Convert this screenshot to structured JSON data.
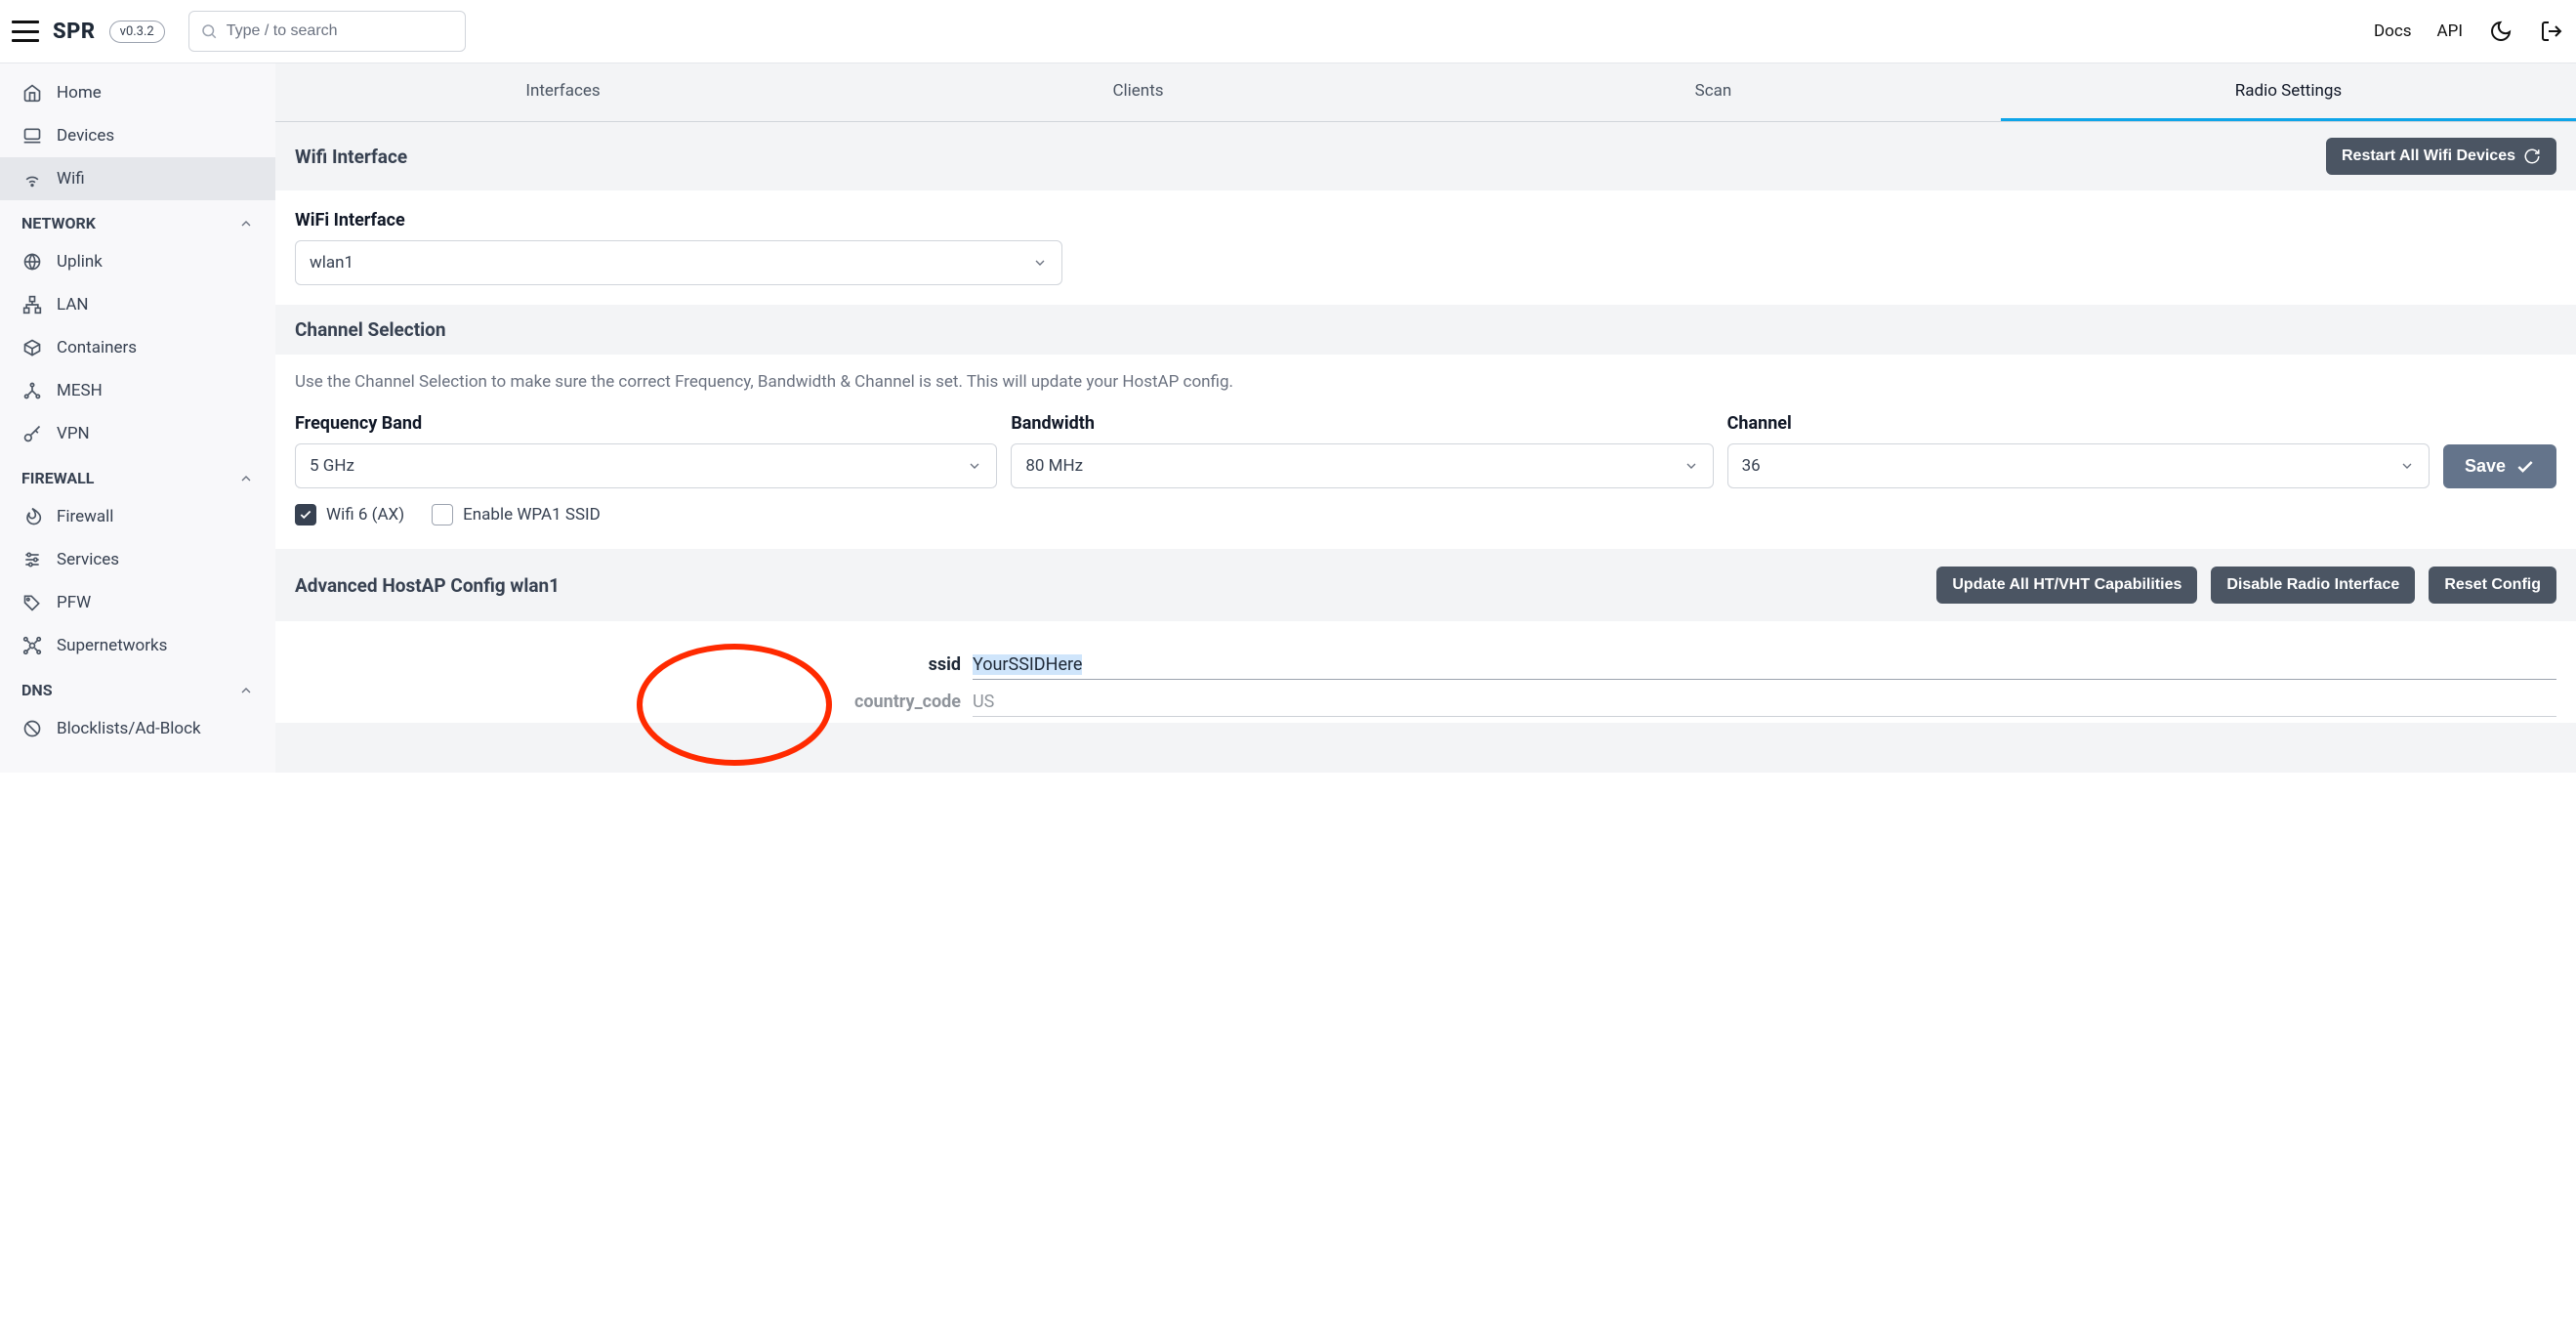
{
  "header": {
    "brand": "SPR",
    "version": "v0.3.2",
    "search_placeholder": "Type / to search",
    "links": {
      "docs": "Docs",
      "api": "API"
    }
  },
  "sidebar": {
    "items_top": [
      {
        "label": "Home",
        "icon": "home"
      },
      {
        "label": "Devices",
        "icon": "laptop"
      },
      {
        "label": "Wifi",
        "icon": "wifi",
        "active": true
      }
    ],
    "groups": [
      {
        "title": "NETWORK",
        "items": [
          {
            "label": "Uplink",
            "icon": "globe"
          },
          {
            "label": "LAN",
            "icon": "diagram"
          },
          {
            "label": "Containers",
            "icon": "box"
          },
          {
            "label": "MESH",
            "icon": "mesh"
          },
          {
            "label": "VPN",
            "icon": "key"
          }
        ]
      },
      {
        "title": "FIREWALL",
        "items": [
          {
            "label": "Firewall",
            "icon": "flame"
          },
          {
            "label": "Services",
            "icon": "sliders"
          },
          {
            "label": "PFW",
            "icon": "tag"
          },
          {
            "label": "Supernetworks",
            "icon": "network"
          }
        ]
      },
      {
        "title": "DNS",
        "items": [
          {
            "label": "Blocklists/Ad-Block",
            "icon": "ban"
          }
        ]
      }
    ]
  },
  "tabs": [
    {
      "label": "Interfaces"
    },
    {
      "label": "Clients"
    },
    {
      "label": "Scan"
    },
    {
      "label": "Radio Settings",
      "active": true
    }
  ],
  "wifi_interface": {
    "section_title": "Wifi Interface",
    "restart_btn": "Restart All Wifi Devices",
    "label": "WiFi Interface",
    "value": "wlan1"
  },
  "channel": {
    "section_title": "Channel Selection",
    "help": "Use the Channel Selection to make sure the correct Frequency, Bandwidth & Channel is set. This will update your HostAP config.",
    "fields": {
      "freq": {
        "label": "Frequency Band",
        "value": "5 GHz"
      },
      "bw": {
        "label": "Bandwidth",
        "value": "80 MHz"
      },
      "ch": {
        "label": "Channel",
        "value": "36"
      }
    },
    "save": "Save",
    "checkboxes": {
      "wifi6": "Wifi 6 (AX)",
      "wpa1": "Enable WPA1 SSID"
    }
  },
  "advanced": {
    "title": "Advanced HostAP Config wlan1",
    "buttons": {
      "update": "Update All HT/VHT Capabilities",
      "disable": "Disable Radio Interface",
      "reset": "Reset Config"
    },
    "kv": [
      {
        "key": "ssid",
        "value": "YourSSIDHere",
        "highlighted": true
      },
      {
        "key": "country_code",
        "value": "US"
      }
    ]
  }
}
